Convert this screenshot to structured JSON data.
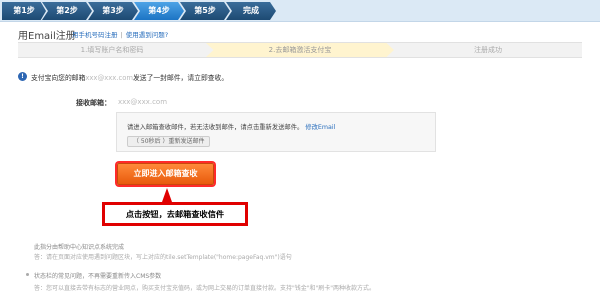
{
  "steps": [
    "第1步",
    "第2步",
    "第3步",
    "第4步",
    "第5步",
    "完成"
  ],
  "header": {
    "title": "用Email注册",
    "link1": "用手机号码注册",
    "link2": "使用遇到问题?"
  },
  "progress": [
    "1.填写账户名和密码",
    "2.去邮箱激活支付宝",
    "注册成功"
  ],
  "info": {
    "prefix": "支付宝向您的邮箱",
    "email_masked": "xxx@xxx.com",
    "suffix": "发送了一封邮件，请立即查收。"
  },
  "receive": {
    "label": "接收邮箱：",
    "value": "xxx@xxx.com"
  },
  "notice": {
    "text": "请进入邮箱查收邮件，若无法收到邮件，请点击重新发送邮件。",
    "link": "修改Email",
    "resend": "（ 50秒后 ）重新发送邮件"
  },
  "primary_button": "立即进入邮箱查收",
  "callout": "点击按钮，去邮箱查收信件",
  "faq": {
    "q1": "此指分由帮助中心知识点系统完成",
    "a1": "答：请在页面对应使用遇到问题区块，写上对应的tile.setTemplate(\"home:pageFaq.vm\")语句",
    "q2": "状态栏的常见问题，不再需要重新传入CMS参数",
    "a2": "答：您可以直接去带有标志的营业网点，购买支付宝充值码，或为网上交易的订单直接付款。支持\"钱金\"和\"刷卡\"两种收款方式。"
  }
}
